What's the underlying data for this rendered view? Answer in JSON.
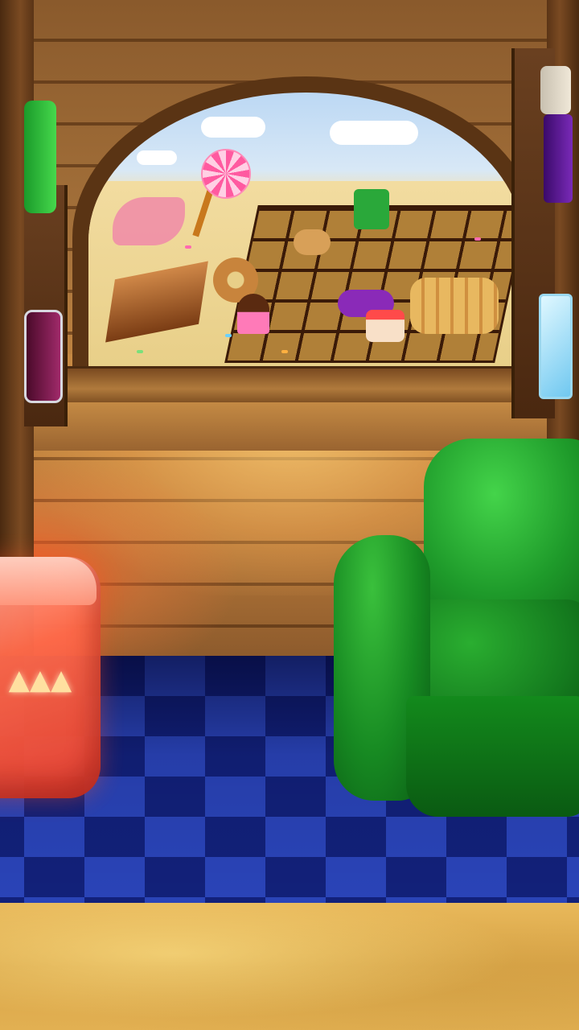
{
  "scene": {
    "name": "candy-house-interior",
    "colors": {
      "wood": "#a8743c",
      "floor_dark": "#12217a",
      "floor_light": "#2a44b8",
      "chair": "#1e9a2a",
      "jelly_cube": "#ff6a4a",
      "ground_panel": "#e2b052"
    },
    "objects": [
      "wooden-wall",
      "arched-window",
      "candy-land-view",
      "red-jelly-cube",
      "green-armchair",
      "checkered-floor",
      "left-shelf",
      "right-shelf"
    ],
    "icons": {
      "cube_symbol": "triforce-icon"
    }
  },
  "cube_symbol_glyph": "▲▲▲"
}
